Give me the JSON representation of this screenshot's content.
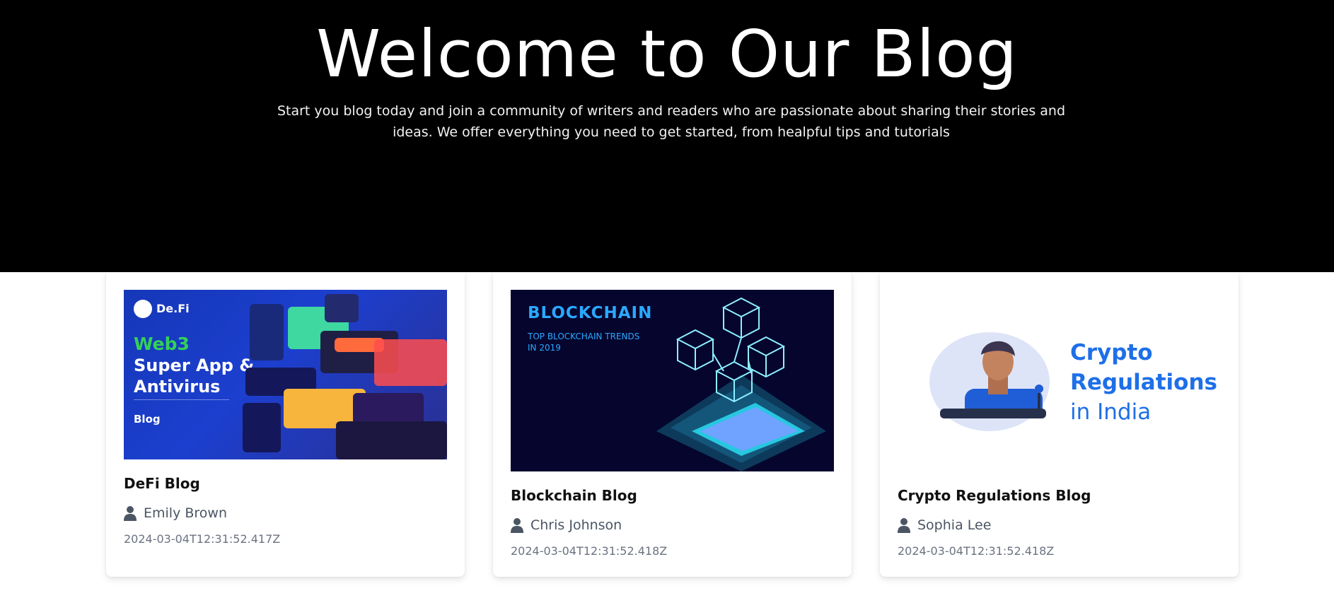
{
  "hero": {
    "title": "Welcome to Our Blog",
    "subtitle": "Start you blog today and join a community of writers and readers who are passionate about sharing their stories and ideas. We offer everything you need to get started, from healpful tips and tutorials"
  },
  "posts": [
    {
      "title": "DeFi Blog",
      "author": "Emily Brown",
      "date": "2024-03-04T12:31:52.417Z",
      "image": {
        "brand": "De.Fi",
        "line1": "Web3",
        "line2": "Super App &",
        "line3": "Antivirus",
        "tag": "Blog"
      }
    },
    {
      "title": "Blockchain Blog",
      "author": "Chris Johnson",
      "date": "2024-03-04T12:31:52.418Z",
      "image": {
        "heading": "BLOCKCHAIN",
        "caption": "TOP BLOCKCHAIN TRENDS IN 2019"
      }
    },
    {
      "title": "Crypto Regulations Blog",
      "author": "Sophia Lee",
      "date": "2024-03-04T12:31:52.418Z",
      "image": {
        "line1": "Crypto",
        "line2": "Regulations",
        "line3": "in India"
      }
    }
  ],
  "colors": {
    "hero_bg": "#000000",
    "accent_blue": "#1e6fe8",
    "text_muted": "#6b7280"
  },
  "icons": [
    "user-icon"
  ]
}
